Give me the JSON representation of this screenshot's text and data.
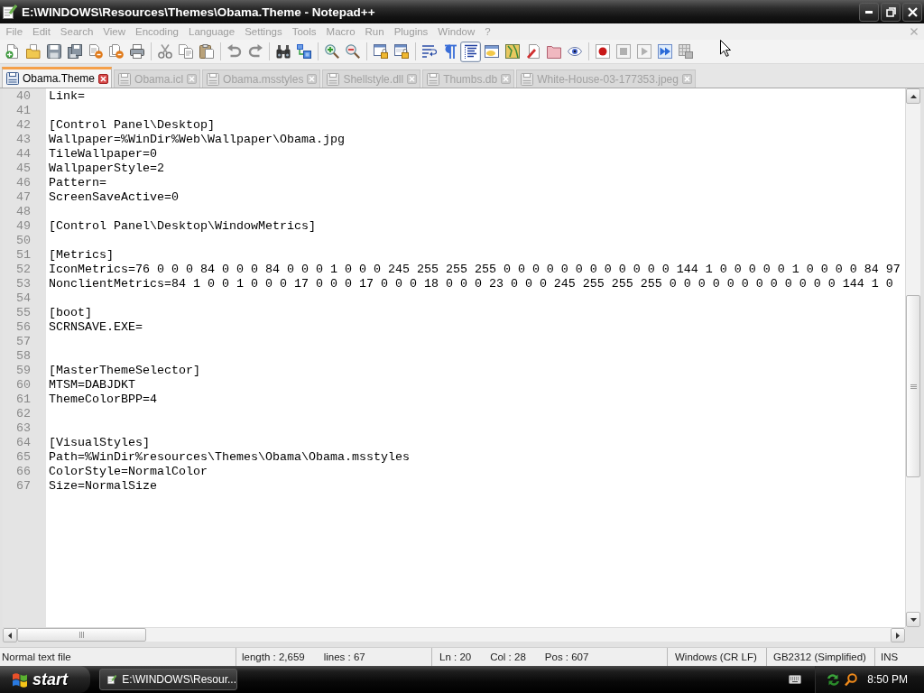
{
  "window": {
    "title": "E:\\WINDOWS\\Resources\\Themes\\Obama.Theme - Notepad++"
  },
  "menu": [
    "File",
    "Edit",
    "Search",
    "View",
    "Encoding",
    "Language",
    "Settings",
    "Tools",
    "Macro",
    "Run",
    "Plugins",
    "Window",
    "?"
  ],
  "toolbar": [
    {
      "on": false
    },
    {
      "on": false
    },
    {
      "on": false
    },
    {
      "on": false
    },
    {
      "on": false
    },
    {
      "on": false
    },
    {
      "on": false
    },
    {
      "on": false
    },
    {
      "on": false
    },
    {
      "on": false
    },
    {
      "on": false
    },
    {
      "on": false
    },
    {
      "on": false
    },
    {
      "on": false
    },
    {
      "on": false
    },
    {
      "on": false
    },
    {
      "on": false
    },
    {
      "on": false
    },
    {
      "on": false
    },
    {
      "on": false
    },
    {
      "on": true
    },
    {
      "on": false
    },
    {
      "on": false
    },
    {
      "on": false
    },
    {
      "on": false
    },
    {
      "on": false
    },
    {
      "on": false
    },
    {
      "on": false
    },
    {
      "on": false
    },
    {
      "on": false
    },
    {
      "on": false
    }
  ],
  "tabs": [
    {
      "label": "Obama.Theme",
      "selected": true
    },
    {
      "label": "Obama.icl",
      "selected": false
    },
    {
      "label": "Obama.msstyles",
      "selected": false
    },
    {
      "label": "Shellstyle.dll",
      "selected": false
    },
    {
      "label": "Thumbs.db",
      "selected": false
    },
    {
      "label": "White-House-03-177353.jpeg",
      "selected": false
    }
  ],
  "editor": {
    "lines": [
      {
        "number": "40",
        "text": "Link="
      },
      {
        "number": "41"
      },
      {
        "number": "42",
        "text": "[Control Panel\\Desktop]"
      },
      {
        "number": "43",
        "text": "Wallpaper=%WinDir%Web\\Wallpaper\\Obama.jpg"
      },
      {
        "number": "44",
        "text": "TileWallpaper=0"
      },
      {
        "number": "45",
        "text": "WallpaperStyle=2"
      },
      {
        "number": "46",
        "text": "Pattern="
      },
      {
        "number": "47",
        "text": "ScreenSaveActive=0"
      },
      {
        "number": "48"
      },
      {
        "number": "49",
        "text": "[Control Panel\\Desktop\\WindowMetrics]"
      },
      {
        "number": "50"
      },
      {
        "number": "51",
        "text": "[Metrics]"
      },
      {
        "number": "52",
        "text": "IconMetrics=76 0 0 0 84 0 0 0 84 0 0 0 1 0 0 0 245 255 255 255 0 0 0 0 0 0 0 0 0 0 0 0 144 1 0 0 0 0 0 1 0 0 0 0 84 97"
      },
      {
        "number": "53",
        "text": "NonclientMetrics=84 1 0 0 1 0 0 0 17 0 0 0 17 0 0 0 18 0 0 0 23 0 0 0 245 255 255 255 0 0 0 0 0 0 0 0 0 0 0 0 144 1 0"
      },
      {
        "number": "54"
      },
      {
        "number": "55",
        "text": "[boot]"
      },
      {
        "number": "56",
        "text": "SCRNSAVE.EXE="
      },
      {
        "number": "57"
      },
      {
        "number": "58"
      },
      {
        "number": "59",
        "text": "[MasterThemeSelector]"
      },
      {
        "number": "60",
        "text": "MTSM=DABJDKT"
      },
      {
        "number": "61",
        "text": "ThemeColorBPP=4"
      },
      {
        "number": "62"
      },
      {
        "number": "63"
      },
      {
        "number": "64",
        "text": "[VisualStyles]"
      },
      {
        "number": "65",
        "text": "Path=%WinDir%resources\\Themes\\Obama\\Obama.msstyles"
      },
      {
        "number": "66",
        "text": "ColorStyle=NormalColor"
      },
      {
        "number": "67",
        "text": "Size=NormalSize"
      }
    ]
  },
  "status_bar": {
    "file_type": "Normal text file",
    "length": "length : 2,659",
    "lines": "lines : 67",
    "line": "Ln : 20",
    "column": "Col : 28",
    "position": "Pos : 607",
    "eol": "Windows (CR LF)",
    "encoding": "GB2312 (Simplified)",
    "mode": "INS"
  },
  "taskbar": {
    "start_label": "start",
    "tasks": [
      {
        "label": "E:\\WINDOWS\\Resour...",
        "selected": true
      }
    ],
    "clock": "8:50 PM"
  }
}
